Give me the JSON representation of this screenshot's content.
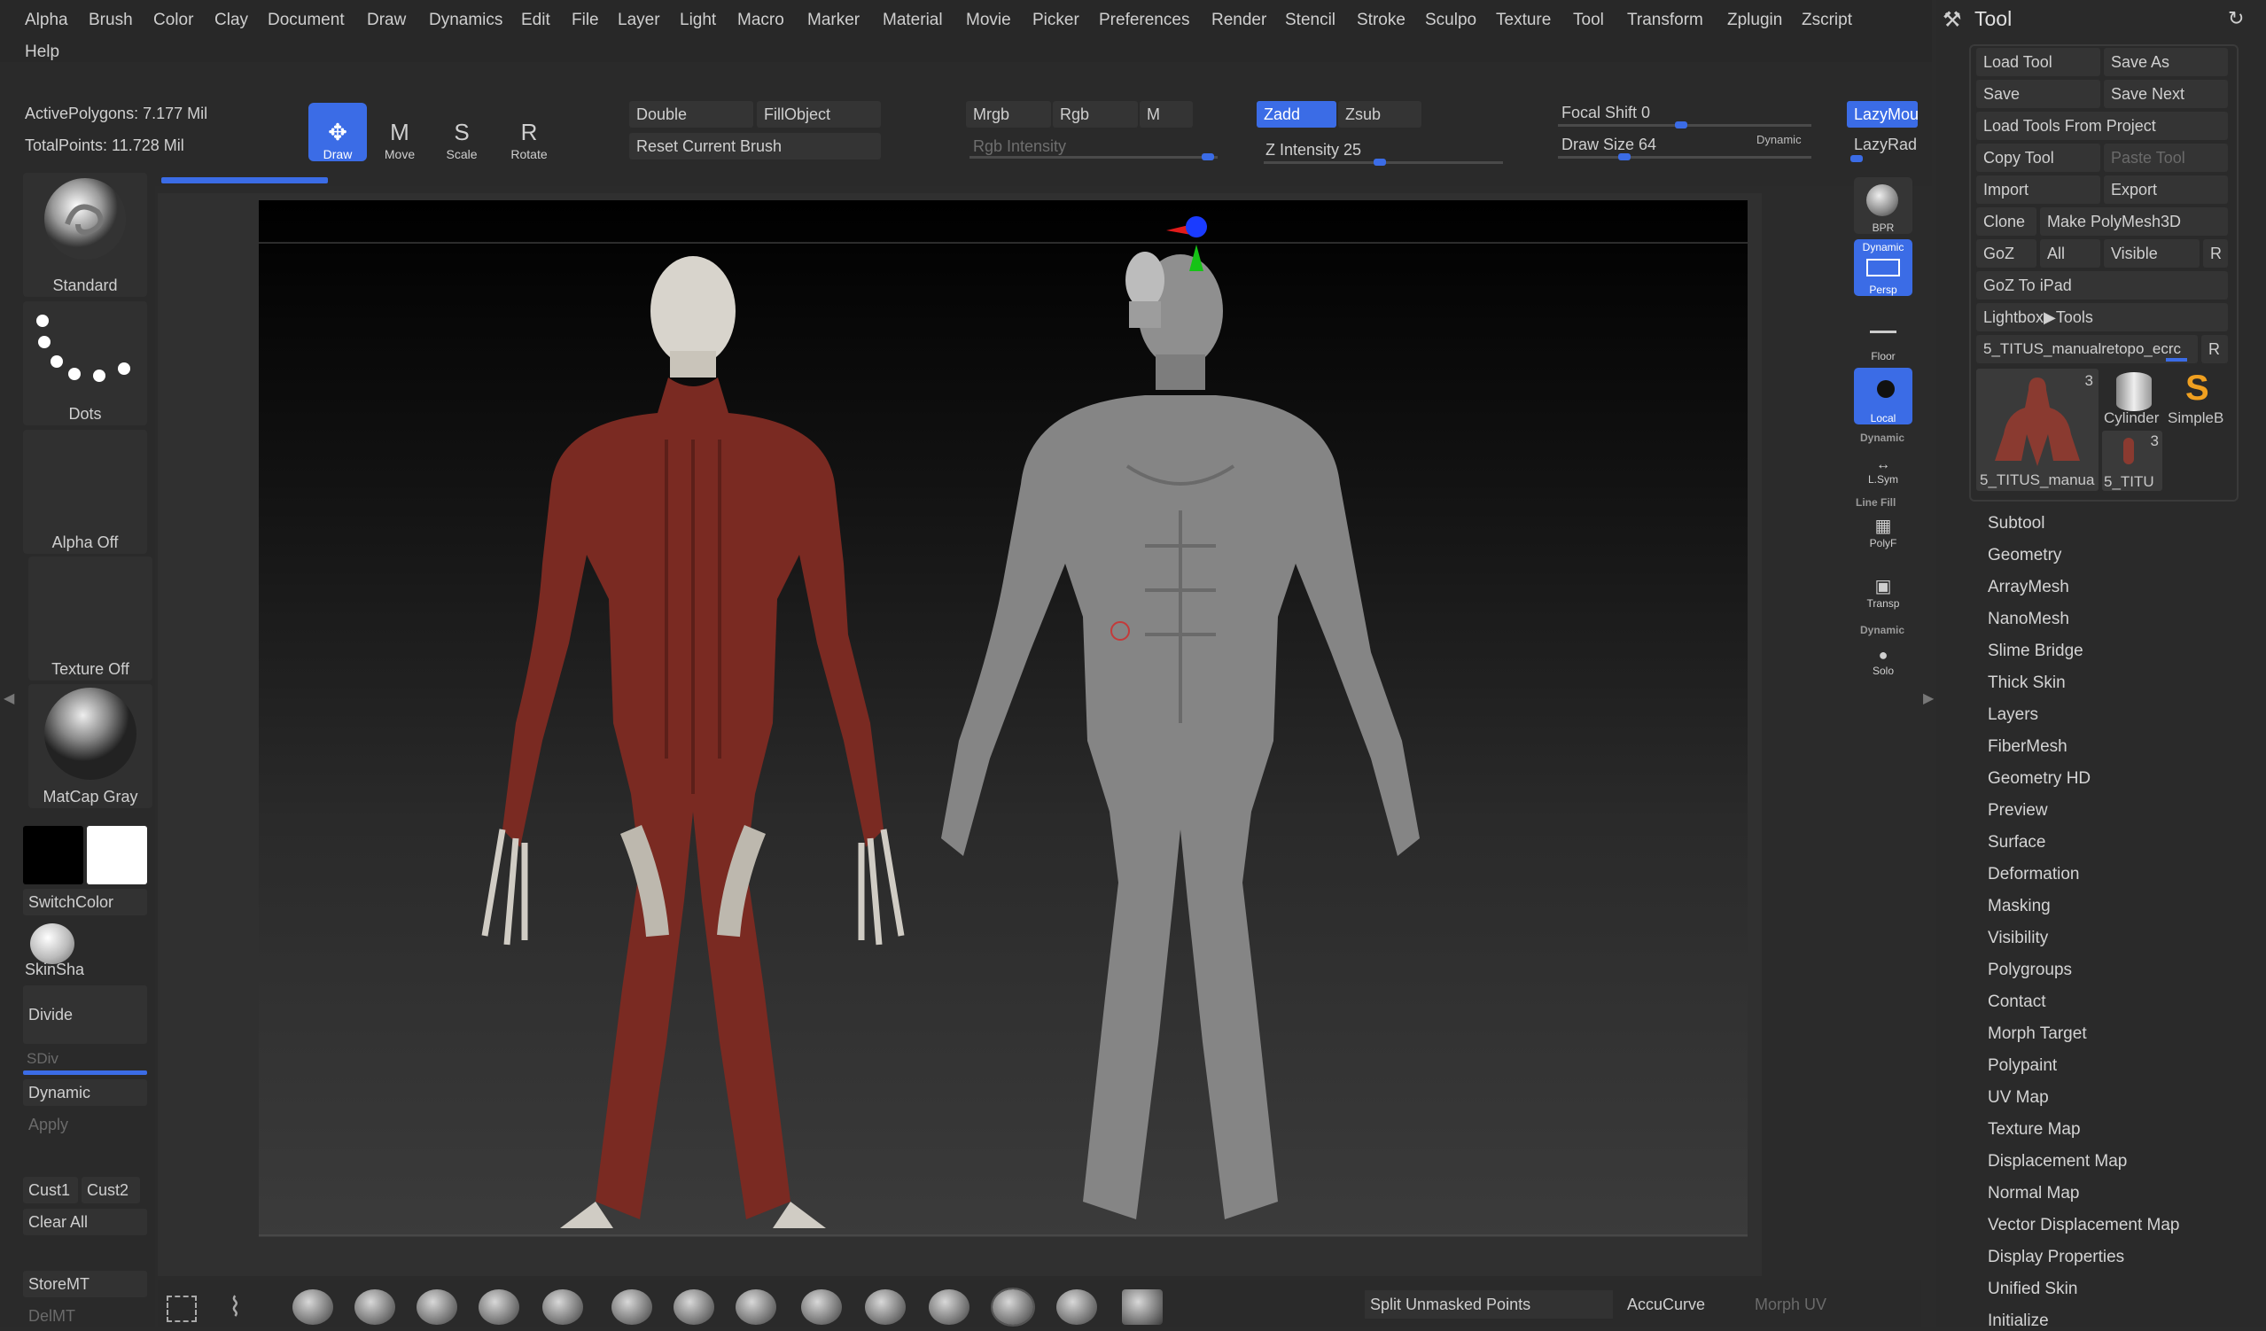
{
  "menubar": {
    "items": [
      "Alpha",
      "Brush",
      "Color",
      "Clay",
      "Document",
      "Draw",
      "Dynamics",
      "Edit",
      "File",
      "Layer",
      "Light",
      "Macro",
      "Marker",
      "Material",
      "Movie",
      "Picker",
      "Preferences",
      "Render",
      "Stencil",
      "Stroke",
      "Sculpo",
      "Texture",
      "Tool",
      "Transform",
      "Zplugin",
      "Zscript"
    ],
    "help": "Help"
  },
  "stats": {
    "active_polygons": "ActivePolygons: 7.177 Mil",
    "total_points": "TotalPoints: 11.728 Mil"
  },
  "transform": {
    "draw": "Draw",
    "move": "Move",
    "scale": "Scale",
    "rotate": "Rotate",
    "move_key": "M",
    "scale_key": "S",
    "rotate_key": "R"
  },
  "brush_opts": {
    "double": "Double",
    "fill_object": "FillObject",
    "reset_brush": "Reset Current Brush"
  },
  "color_opts": {
    "mrgb": "Mrgb",
    "rgb": "Rgb",
    "m": "M",
    "rgb_intensity": "Rgb Intensity"
  },
  "z_opts": {
    "zadd": "Zadd",
    "zsub": "Zsub",
    "z_intensity": "Z Intensity 25"
  },
  "draw_opts": {
    "focal_shift": "Focal Shift 0",
    "draw_size": "Draw Size 64",
    "dynamic": "Dynamic",
    "lazy_mouse": "LazyMou",
    "lazy_radius": "LazyRadi"
  },
  "left_shelf": {
    "brush": "Standard",
    "stroke": "Dots",
    "alpha": "Alpha Off",
    "texture": "Texture Off",
    "material": "MatCap Gray",
    "switch_color": "SwitchColor",
    "skin_shade": "SkinSha",
    "divide": "Divide",
    "sdiv": "SDiv",
    "dynamic": "Dynamic",
    "apply": "Apply",
    "cust1": "Cust1",
    "cust2": "Cust2",
    "clear_all": "Clear All",
    "store_mt": "StoreMT",
    "del_mt": "DelMT"
  },
  "right_shelf": {
    "bpr": "BPR",
    "dynamic_top": "Dynamic",
    "persp": "Persp",
    "floor": "Floor",
    "local": "Local",
    "dynamic_sym": "Dynamic",
    "lsym": "L.Sym",
    "line_fill": "Line Fill",
    "polyf": "PolyF",
    "transp": "Transp",
    "dynamic_solo": "Dynamic",
    "solo": "Solo"
  },
  "tool_panel": {
    "title": "Tool",
    "load_tool": "Load Tool",
    "save_as": "Save As",
    "save": "Save",
    "save_next": "Save Next",
    "load_from_project": "Load Tools From Project",
    "copy_tool": "Copy Tool",
    "paste_tool": "Paste Tool",
    "import": "Import",
    "export": "Export",
    "clone": "Clone",
    "make_polymesh": "Make PolyMesh3D",
    "goz": "GoZ",
    "all": "All",
    "visible": "Visible",
    "r": "R",
    "goz_ipad": "GoZ To iPad",
    "lightbox_tools": "Lightbox▶Tools",
    "current_tool": "5_TITUS_manualretopo_ecrc",
    "current_r": "R",
    "thumb_main_label": "5_TITUS_manua",
    "thumb_main_count": "3",
    "thumb_cylinder": "Cylinder",
    "thumb_simpleb": "SimpleB",
    "thumb_small_label": "5_TITU",
    "thumb_small_count": "3",
    "sections": [
      "Subtool",
      "Geometry",
      "ArrayMesh",
      "NanoMesh",
      "Slime Bridge",
      "Thick Skin",
      "Layers",
      "FiberMesh",
      "Geometry HD",
      "Preview",
      "Surface",
      "Deformation",
      "Masking",
      "Visibility",
      "Polygroups",
      "Contact",
      "Morph Target",
      "Polypaint",
      "UV Map",
      "Texture Map",
      "Displacement Map",
      "Normal Map",
      "Vector Displacement Map",
      "Display Properties",
      "Unified Skin",
      "Initialize"
    ]
  },
  "bottom": {
    "split_unmasked": "Split Unmasked Points",
    "accucurve": "AccuCurve",
    "morph_uv": "Morph UV"
  },
  "colors": {
    "accent": "#3b6ce6",
    "muscle": "#7a2a22",
    "bone": "#d8d4cc",
    "sculpt_gray": "#8a8a8a"
  }
}
